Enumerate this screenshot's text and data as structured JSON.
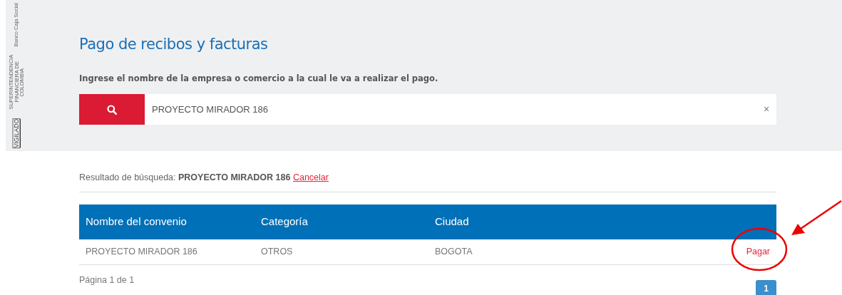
{
  "side_badge": {
    "vigilado": "VIGILADO",
    "regulator": "SUPERINTENDENCIA FINANCIERA DE COLOMBIA",
    "bank": "Banco Caja Social"
  },
  "header": {
    "title": "Pago de recibos y facturas",
    "instruction": "Ingrese el nombre de la empresa o comercio a la cual le va a realizar el pago.",
    "search": {
      "value": "PROYECTO MIRADOR 186",
      "clear": "×"
    }
  },
  "result": {
    "label": "Resultado de búsqueda:",
    "query": "PROYECTO MIRADOR 186",
    "cancel": "Cancelar"
  },
  "table": {
    "columns": [
      "Nombre del convenio",
      "Categoría",
      "Ciudad"
    ],
    "rows": [
      {
        "name": "PROYECTO MIRADOR 186",
        "category": "OTROS",
        "city": "BOGOTA",
        "action": "Pagar",
        "highlighted": true
      }
    ]
  },
  "page_info": "Página 1 de 1",
  "pagination": [
    {
      "label": "1",
      "selected": true
    }
  ]
}
